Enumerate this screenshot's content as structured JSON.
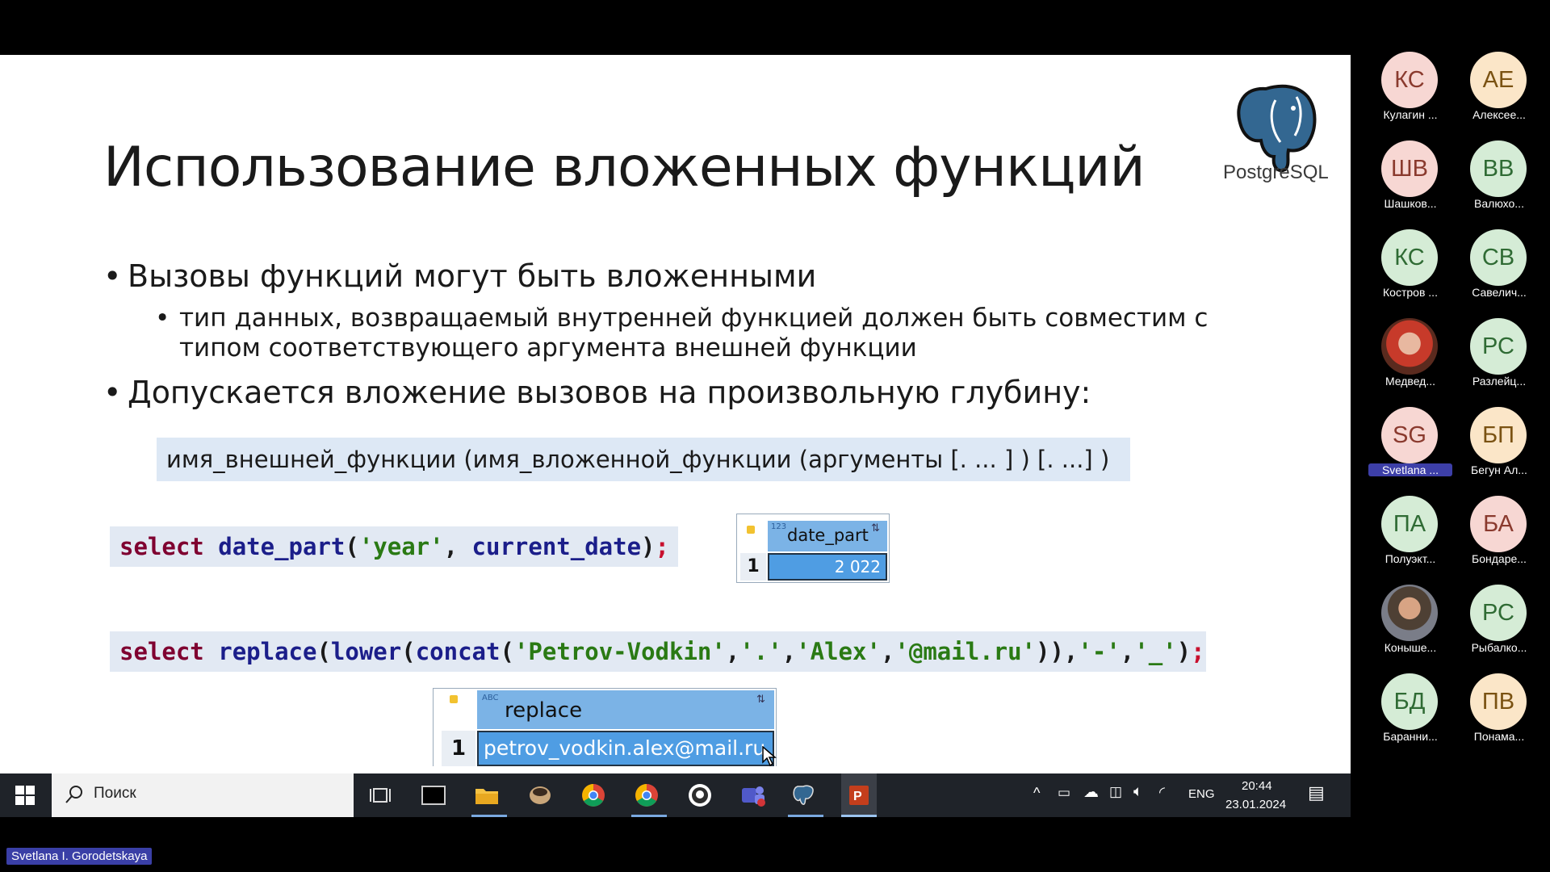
{
  "slide": {
    "title": "Использование вложенных функций",
    "logo_text": "PostgreSQL",
    "bullets": [
      "Вызовы функций могут быть вложенными",
      "Допускается вложение вызовов на произвольную глубину:"
    ],
    "sub_bullet_lines": [
      "тип данных, возвращаемый внутренней функцией должен быть совместим с",
      "типом соответствующего аргумента внешней функции"
    ],
    "syntax": "имя_внешней_функции (имя_вложенной_функции (аргументы [. ... ] ) [. ...] )",
    "code1": {
      "kw": "select",
      "fn": "date_part",
      "open": "(",
      "arg1": "'year'",
      "sep": ", ",
      "fn2": "current_date",
      "close": ")",
      "semi": ";"
    },
    "result1": {
      "type_label": "123",
      "column": "date_part",
      "row_num": "1",
      "value": "2 022"
    },
    "code2": {
      "kw": "select",
      "fn1": "replace",
      "fn2": "lower",
      "fn3": "concat",
      "a1": "'Petrov-Vodkin'",
      "a2": "'.'",
      "a3": "'Alex'",
      "a4": "'@mail.ru'",
      "a5": "'-'",
      "a6": "'_'",
      "semi": ";"
    },
    "result2": {
      "type_label": "ABC",
      "column": "replace",
      "row_num": "1",
      "value": "petrov_vodkin.alex@mail.ru"
    }
  },
  "participants": [
    {
      "initials": "КС",
      "name": "Кулагин ...",
      "bg": "#f7d7d3",
      "fg": "#8a3a2e"
    },
    {
      "initials": "АЕ",
      "name": "Алексее...",
      "bg": "#fbe6c8",
      "fg": "#7a5212"
    },
    {
      "initials": "ШВ",
      "name": "Шашков...",
      "bg": "#f7d7d3",
      "fg": "#8a3a2e"
    },
    {
      "initials": "ВВ",
      "name": "Валюхо...",
      "bg": "#d5ecd6",
      "fg": "#2f6b34"
    },
    {
      "initials": "КС",
      "name": "Костров ...",
      "bg": "#d5ecd6",
      "fg": "#2f6b34"
    },
    {
      "initials": "СВ",
      "name": "Савелич...",
      "bg": "#d5ecd6",
      "fg": "#2f6b34"
    },
    {
      "initials": "",
      "name": "Медвед...",
      "bg": "",
      "fg": ""
    },
    {
      "initials": "РС",
      "name": "Разлейц...",
      "bg": "#d5ecd6",
      "fg": "#2f6b34"
    },
    {
      "initials": "SG",
      "name": "Svetlana ...",
      "bg": "#f7d7d3",
      "fg": "#8a3a2e"
    },
    {
      "initials": "БП",
      "name": "Бегун Ал...",
      "bg": "#fbe6c8",
      "fg": "#7a5212"
    },
    {
      "initials": "ПА",
      "name": "Полуэкт...",
      "bg": "#d5ecd6",
      "fg": "#2f6b34"
    },
    {
      "initials": "БА",
      "name": "Бондаре...",
      "bg": "#f7d7d3",
      "fg": "#8a3a2e"
    },
    {
      "initials": "",
      "name": "Коныше...",
      "bg": "",
      "fg": ""
    },
    {
      "initials": "РС",
      "name": "Рыбалко...",
      "bg": "#d5ecd6",
      "fg": "#2f6b34"
    },
    {
      "initials": "БД",
      "name": "Баранни...",
      "bg": "#d5ecd6",
      "fg": "#2f6b34"
    },
    {
      "initials": "ПВ",
      "name": "Понама...",
      "bg": "#fbe6c8",
      "fg": "#7a5212"
    }
  ],
  "taskbar": {
    "search_placeholder": "Поиск",
    "lang": "ENG",
    "time": "20:44",
    "date": "23.01.2024"
  },
  "presenter_tag": "Svetlana I. Gorodetskaya"
}
